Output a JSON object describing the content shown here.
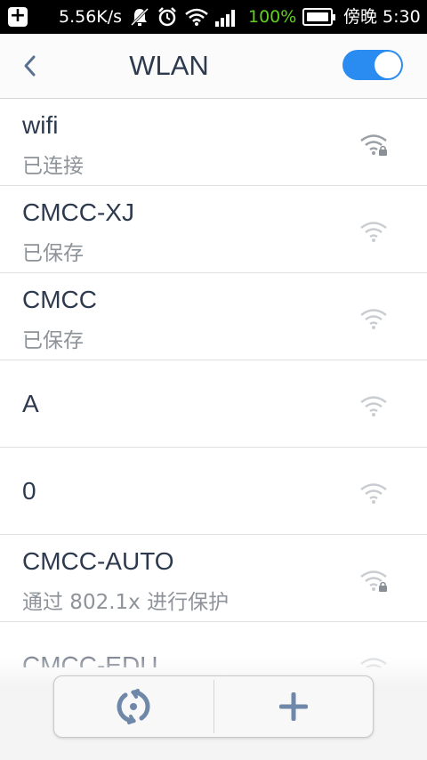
{
  "status_bar": {
    "network_speed": "5.56K/s",
    "battery_percent": "100%",
    "time": "傍晚 5:30",
    "icons": [
      "add-icon",
      "bell-muted-icon",
      "alarm-icon",
      "wifi-icon",
      "signal-icon",
      "battery-charging-icon"
    ]
  },
  "header": {
    "title": "WLAN",
    "wlan_enabled": true
  },
  "networks": [
    {
      "ssid": "wifi",
      "status": "已连接",
      "secured": true,
      "connected": true
    },
    {
      "ssid": "CMCC-XJ",
      "status": "已保存",
      "secured": false
    },
    {
      "ssid": "CMCC",
      "status": "已保存",
      "secured": false
    },
    {
      "ssid": "A",
      "status": "",
      "secured": false
    },
    {
      "ssid": "0",
      "status": "",
      "secured": false
    },
    {
      "ssid": "CMCC-AUTO",
      "status": "通过 802.1x 进行保护",
      "secured": true
    },
    {
      "ssid": "CMCC-EDU",
      "status": "",
      "secured": false
    }
  ],
  "bottom_bar": {
    "buttons": [
      "refresh-icon",
      "add-icon"
    ]
  },
  "colors": {
    "accent": "#2a8cf0",
    "title": "#2d3a4e",
    "connected_status": "#8e9399"
  }
}
